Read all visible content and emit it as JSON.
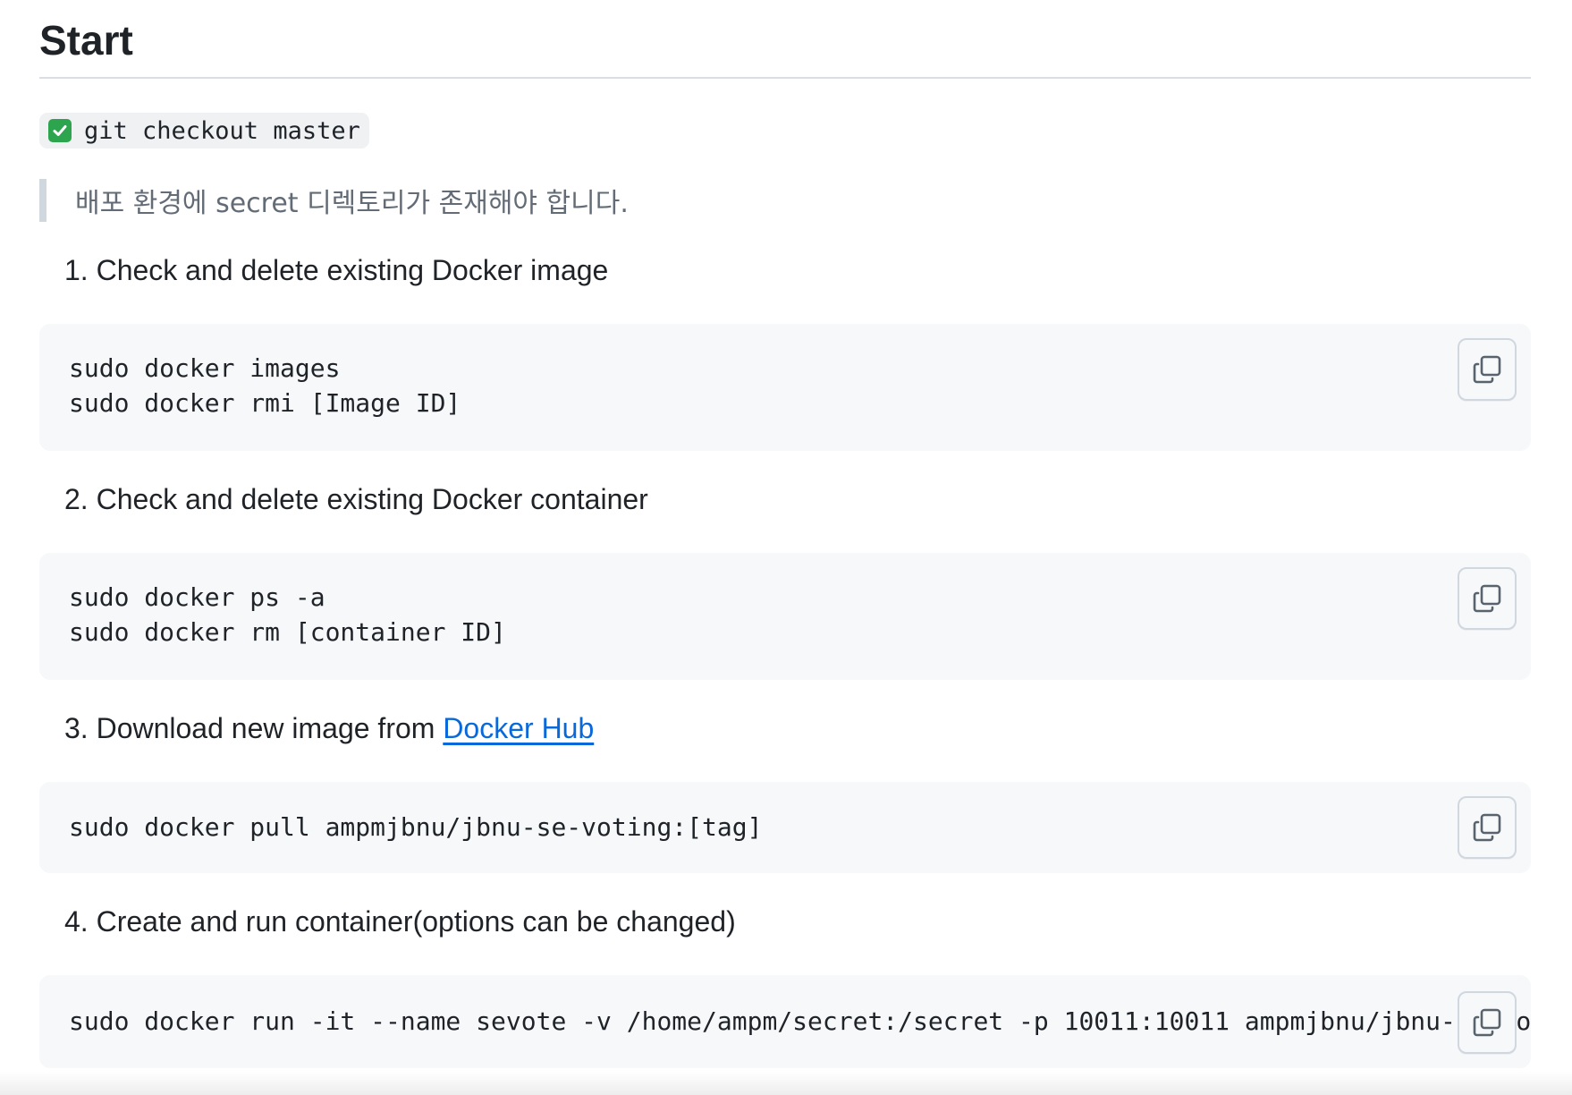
{
  "heading": "Start",
  "checkout": {
    "icon": "check-mark-button-icon",
    "code": "git checkout master"
  },
  "note": "배포 환경에 secret 디렉토리가 존재해야 합니다.",
  "steps": [
    {
      "title": "1. Check and delete existing Docker image",
      "code": [
        "sudo docker images",
        "sudo docker rmi [Image ID]"
      ]
    },
    {
      "title": "2. Check and delete existing Docker container",
      "code": [
        "sudo docker ps -a",
        "sudo docker rm [container ID]"
      ]
    },
    {
      "title_prefix": "3. Download new image from ",
      "title_link": "Docker Hub",
      "code": [
        "sudo docker pull ampmjbnu/jbnu-se-voting:[tag]"
      ]
    },
    {
      "title": "4. Create and run container(options can be changed)",
      "code": [
        "sudo docker run -it --name sevote -v /home/ampm/secret:/secret -p 10011:10011 ampmjbnu/jbnu-se-voting:[tag]"
      ]
    }
  ],
  "colors": {
    "link": "#0969da",
    "code_bg": "#f6f8fa",
    "check_green": "#2da44e"
  }
}
